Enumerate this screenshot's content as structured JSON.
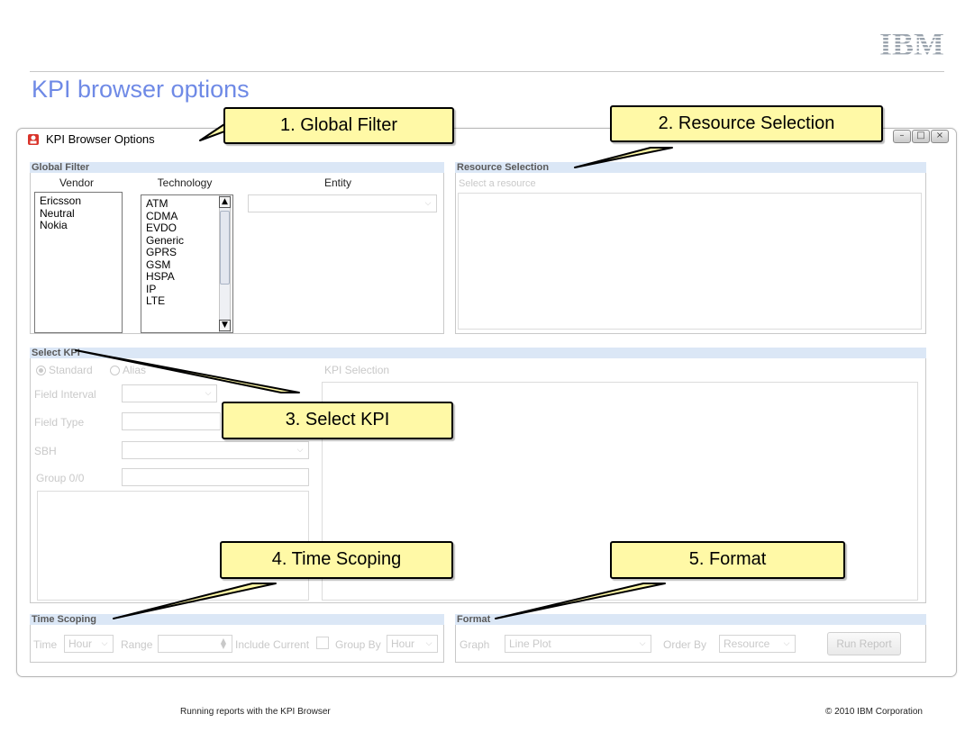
{
  "slide": {
    "title": "KPI browser options",
    "logo": "IBM",
    "footer_left": "Running reports with the KPI Browser",
    "footer_right": "© 2010 IBM Corporation"
  },
  "window": {
    "title": "KPI Browser Options",
    "icon": "app-icon",
    "controls": {
      "minimize": "–",
      "maximize": "□",
      "close": "×"
    }
  },
  "global_filter": {
    "header": "Global Filter",
    "vendor_label": "Vendor",
    "technology_label": "Technology",
    "entity_label": "Entity",
    "vendors": [
      "Ericsson",
      "Neutral",
      "Nokia"
    ],
    "technologies": [
      "ATM",
      "CDMA",
      "EVDO",
      "Generic",
      "GPRS",
      "GSM",
      "HSPA",
      "IP",
      "LTE"
    ],
    "entity_value": ""
  },
  "resource_selection": {
    "header": "Resource Selection",
    "prompt": "Select a resource"
  },
  "select_kpi": {
    "header": "Select KPI",
    "radio_standard": "Standard",
    "radio_alias": "Alias",
    "selected_radio": "Standard",
    "field_interval_label": "Field Interval",
    "field_type_label": "Field Type",
    "sbh_label": "SBH",
    "group_label": "Group 0/0",
    "kpi_selection_label": "KPI Selection"
  },
  "time_scoping": {
    "header": "Time Scoping",
    "time_label": "Time",
    "time_value": "Hour",
    "range_label": "Range",
    "include_current_label": "Include Current",
    "group_by_label": "Group By",
    "group_by_value": "Hour"
  },
  "format": {
    "header": "Format",
    "graph_label": "Graph",
    "graph_value": "Line Plot",
    "order_by_label": "Order By",
    "order_by_value": "Resource",
    "run_button": "Run Report"
  },
  "callouts": {
    "c1": "1. Global Filter",
    "c2": "2. Resource Selection",
    "c3": "3. Select KPI",
    "c4": "4. Time Scoping",
    "c5": "5. Format"
  },
  "colors": {
    "title_blue": "#6f8ae6",
    "callout_fill": "#fff9a6",
    "section_header_bg": "#dbe7f6"
  }
}
